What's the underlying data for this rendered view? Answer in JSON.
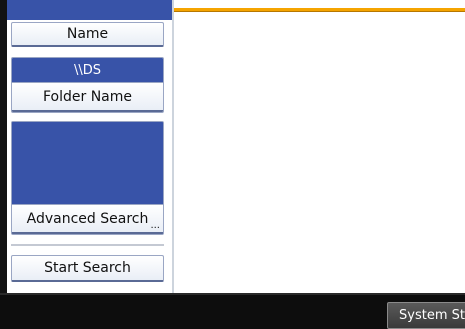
{
  "search_panel": {
    "name_button_label": "Name",
    "folder_path_value": "\\\\DS",
    "folder_name_button_label": "Folder Name",
    "advanced_search_button_label": "Advanced Search",
    "advanced_search_more_indicator": "...",
    "start_search_button_label": "Start Search"
  },
  "footer": {
    "system_status_label": "System Status"
  },
  "colors": {
    "panel_blue": "#3853a8",
    "accent_orange": "#f5a400",
    "footer_black": "#0d0d0d"
  }
}
